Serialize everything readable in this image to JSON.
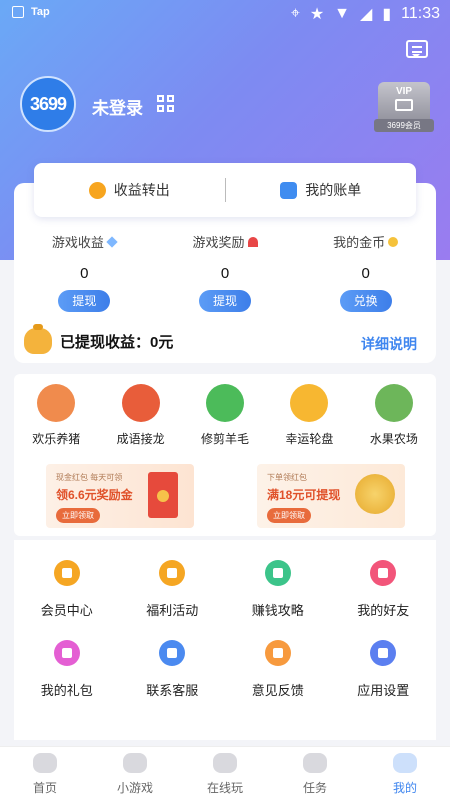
{
  "status_bar": {
    "carrier": "Tap",
    "time": "11:33"
  },
  "profile": {
    "avatar_text": "3699",
    "login_text": "未登录",
    "vip_label": "VIP",
    "vip_sub": "3699会员"
  },
  "transfer_bar": {
    "left_label": "收益转出",
    "right_label": "我的账单"
  },
  "stats": [
    {
      "title": "游戏收益",
      "value": "0",
      "button": "提现",
      "icon": "diamond-icon"
    },
    {
      "title": "游戏奖励",
      "value": "0",
      "button": "提现",
      "icon": "red-envelope-icon"
    },
    {
      "title": "我的金币",
      "value": "0",
      "button": "兑换",
      "icon": "coin-icon"
    }
  ],
  "withdrawn": {
    "text": "已提现收益：0元",
    "detail_link": "详细说明"
  },
  "games": [
    {
      "label": "欢乐养猪",
      "color": "#f08b4d"
    },
    {
      "label": "成语接龙",
      "color": "#e85d3a"
    },
    {
      "label": "修剪羊毛",
      "color": "#4cbb5a"
    },
    {
      "label": "幸运轮盘",
      "color": "#f7b731"
    },
    {
      "label": "水果农场",
      "color": "#6db65a"
    }
  ],
  "banners": [
    {
      "small": "现金红包  每天可领",
      "big": "领6.6元奖励金",
      "cta": "立即领取"
    },
    {
      "small": "下单领红包",
      "big": "满18元可提现",
      "cta": "立即领取"
    }
  ],
  "menu_row1": [
    {
      "label": "会员中心",
      "color": "#f5a623"
    },
    {
      "label": "福利活动",
      "color": "#f5a623"
    },
    {
      "label": "赚钱攻略",
      "color": "#3cc48a"
    },
    {
      "label": "我的好友",
      "color": "#f2557a"
    }
  ],
  "menu_row2": [
    {
      "label": "我的礼包",
      "color": "#e45fd3"
    },
    {
      "label": "联系客服",
      "color": "#4b8af0"
    },
    {
      "label": "意见反馈",
      "color": "#f79a3e"
    },
    {
      "label": "应用设置",
      "color": "#5b7ff0"
    }
  ],
  "tabs": [
    {
      "label": "首页"
    },
    {
      "label": "小游戏"
    },
    {
      "label": "在线玩"
    },
    {
      "label": "任务"
    },
    {
      "label": "我的"
    }
  ]
}
